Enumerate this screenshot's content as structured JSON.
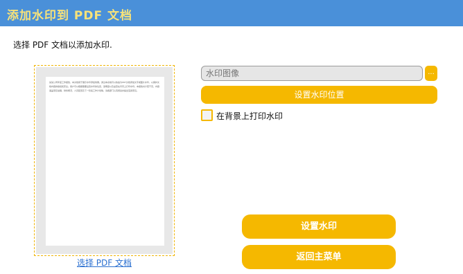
{
  "header": {
    "title": "添加水印到 PDF 文档"
  },
  "instruction": "选择 PDF 文档以添加水印.",
  "preview": {
    "page_text": "某某公司年度工作报告，本文档用于展示水印添加效果。通过本系统可以快速为PDF文档添加文字或图片水印，以保护文档内容的版权和安全。用户可以根据需要设置水印的位置、透明度以及是否在背景上打印水印。本报告共计若干页，内容涵盖项目进展、财务概况、人员配置及下一阶段工作计划等，请各部门认真阅读并提出宝贵意见。"
  },
  "select_link": "选择 PDF 文档",
  "watermark_image": {
    "placeholder": "水印图像",
    "value": ""
  },
  "browse_label": "...",
  "set_position_label": "设置水印位置",
  "background_print": {
    "label": "在背景上打印水印",
    "checked": false
  },
  "actions": {
    "set_watermark": "设置水印",
    "back_to_menu": "返回主菜单"
  },
  "colors": {
    "header": "#4a90d9",
    "title": "#f7e27a",
    "accent": "#f5b800",
    "link": "#2a6fd0"
  }
}
